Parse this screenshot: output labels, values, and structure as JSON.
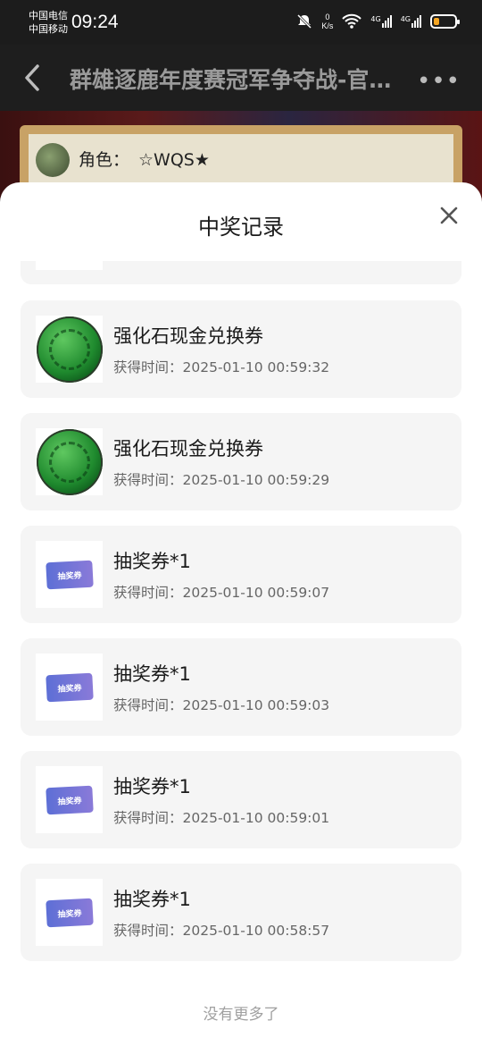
{
  "status_bar": {
    "carrier1": "中国电信",
    "carrier2": "中国移动",
    "time": "09:24",
    "net_speed_value": "0",
    "net_speed_unit": "K/s",
    "net1": "4G",
    "net2": "4G"
  },
  "nav": {
    "title": "群雄逐鹿年度赛冠军争夺战-官方直播间"
  },
  "profile": {
    "role_label": "角色：",
    "role_name": "☆WQS★"
  },
  "sheet": {
    "title": "中奖记录",
    "footer": "没有更多了",
    "items": [
      {
        "name": "强化石现金兑换券",
        "time": "获得时间：2025-01-10 00:59:32",
        "icon": "jade-dragon-icon"
      },
      {
        "name": "强化石现金兑换券",
        "time": "获得时间：2025-01-10 00:59:29",
        "icon": "jade-dragon-icon"
      },
      {
        "name": "抽奖券*1",
        "time": "获得时间：2025-01-10 00:59:07",
        "icon": "lottery-ticket-icon"
      },
      {
        "name": "抽奖券*1",
        "time": "获得时间：2025-01-10 00:59:03",
        "icon": "lottery-ticket-icon"
      },
      {
        "name": "抽奖券*1",
        "time": "获得时间：2025-01-10 00:59:01",
        "icon": "lottery-ticket-icon"
      },
      {
        "name": "抽奖券*1",
        "time": "获得时间：2025-01-10 00:58:57",
        "icon": "lottery-ticket-icon"
      }
    ],
    "ticket_label": "抽奖券"
  },
  "colors": {
    "accent_ticket": "#5d6fd6",
    "jade": "#1f8a2e",
    "battery": "#f5a623"
  }
}
